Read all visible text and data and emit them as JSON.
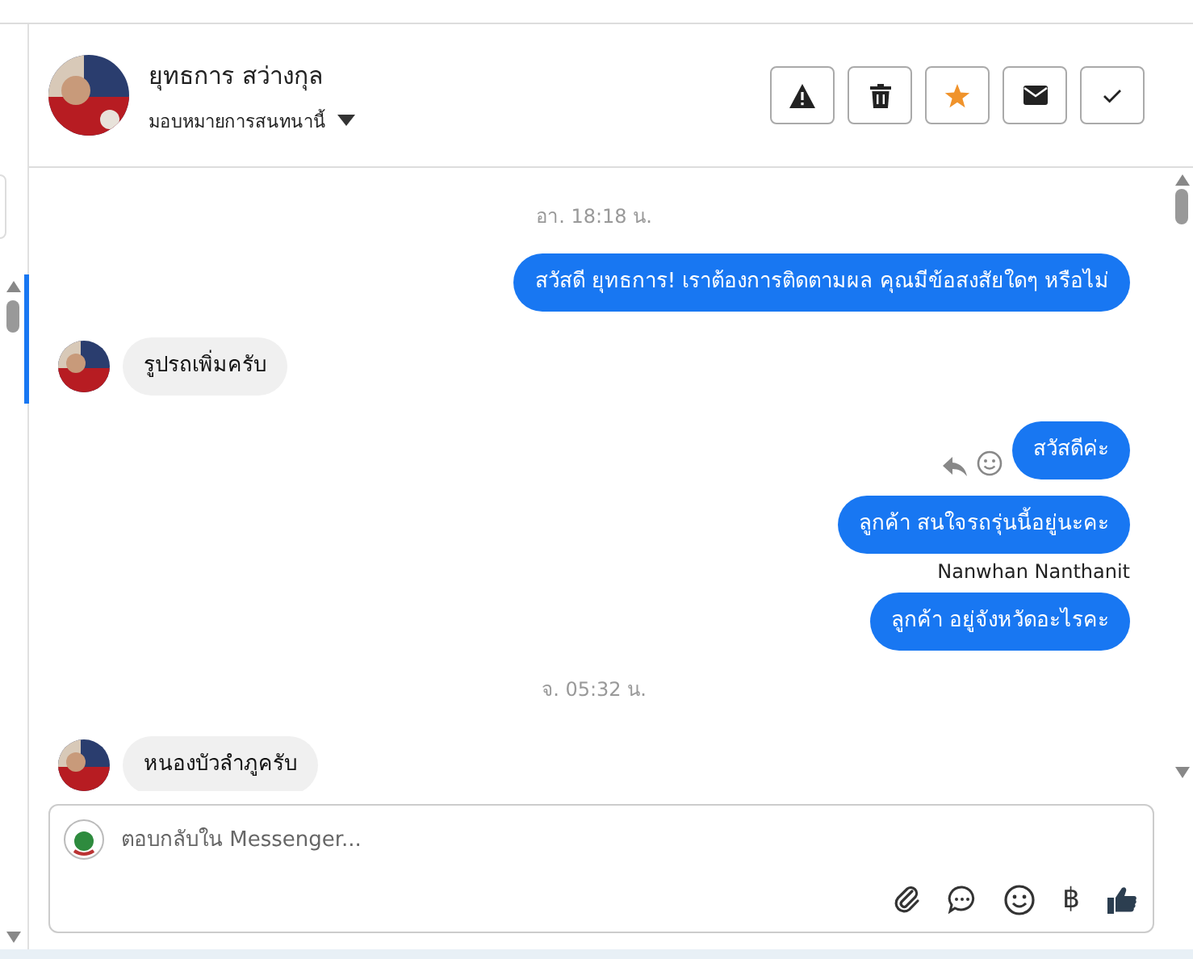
{
  "header": {
    "name": "ยุทธการ สว่างกุล",
    "assign": "มอบหมายการสนทนานี้",
    "actions": [
      {
        "kind": "warning"
      },
      {
        "kind": "trash"
      },
      {
        "kind": "star"
      },
      {
        "kind": "mail"
      },
      {
        "kind": "check"
      }
    ]
  },
  "messages": [
    {
      "kind": "time",
      "text": "อา. 18:18 น."
    },
    {
      "kind": "out",
      "text": "สวัสดี ยุทธการ! เราต้องการติดตามผล คุณมีข้อสงสัยใดๆ หรือไม่",
      "actions": false
    },
    {
      "kind": "in",
      "text": "รูปรถเพิ่มครับ"
    },
    {
      "kind": "out",
      "text": "สวัสดีค่ะ",
      "actions": true
    },
    {
      "kind": "out",
      "text": "ลูกค้า  สนใจรถรุ่นนี้อยู่นะคะ",
      "actions": false
    },
    {
      "kind": "sender",
      "text": "Nanwhan Nanthanit"
    },
    {
      "kind": "out",
      "text": "ลูกค้า  อยู่จังหวัดอะไรคะ",
      "actions": false
    },
    {
      "kind": "time",
      "text": "จ. 05:32 น."
    },
    {
      "kind": "in",
      "text": "หนองบัวลำภูครับ"
    }
  ],
  "composer": {
    "placeholder": "ตอบกลับใน Messenger...",
    "tools": [
      {
        "kind": "attach"
      },
      {
        "kind": "chat"
      },
      {
        "kind": "emoji"
      },
      {
        "kind": "text",
        "text": "฿"
      },
      {
        "kind": "like"
      }
    ]
  }
}
